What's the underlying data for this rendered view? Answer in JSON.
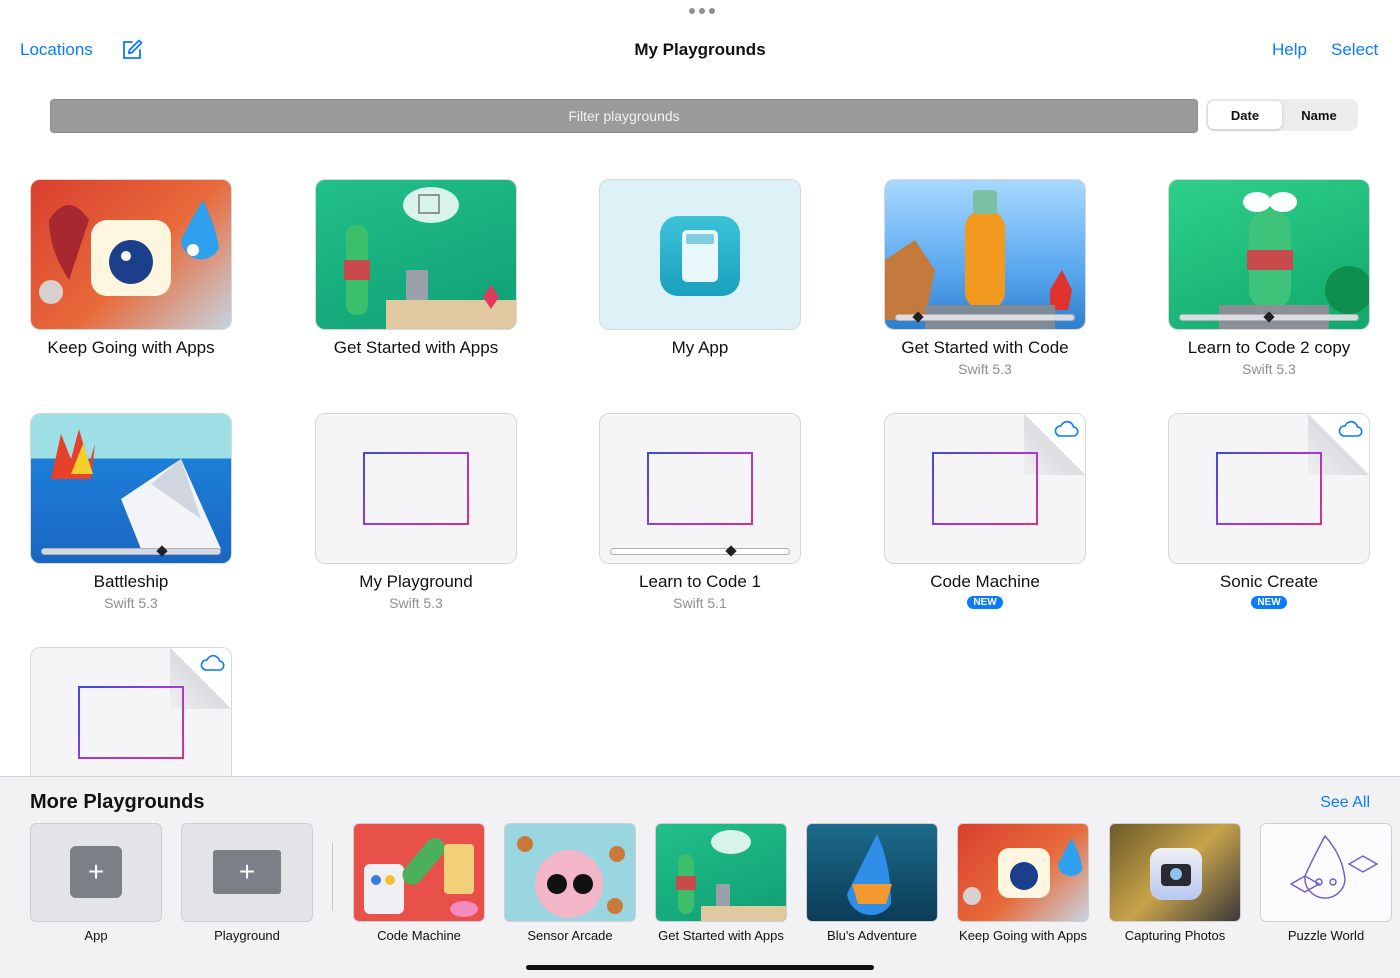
{
  "nav": {
    "locations": "Locations",
    "title": "My Playgrounds",
    "help": "Help",
    "select": "Select"
  },
  "filter": {
    "placeholder": "Filter playgrounds"
  },
  "sort": {
    "date": "Date",
    "name": "Name",
    "selected": "Date"
  },
  "cards": [
    {
      "title": "Keep Going with Apps",
      "subtitle": ""
    },
    {
      "title": "Get Started with Apps",
      "subtitle": ""
    },
    {
      "title": "My App",
      "subtitle": ""
    },
    {
      "title": "Get Started with Code",
      "subtitle": "Swift 5.3",
      "progress": 0.1
    },
    {
      "title": "Learn to Code 2 copy",
      "subtitle": "Swift 5.3",
      "progress": 0.48
    },
    {
      "title": "Battleship",
      "subtitle": "Swift 5.3",
      "progress": 0.65
    },
    {
      "title": "My Playground",
      "subtitle": "Swift 5.3"
    },
    {
      "title": "Learn to Code 1",
      "subtitle": "Swift 5.1",
      "progress": 0.65
    },
    {
      "title": "Code Machine",
      "badge": "NEW"
    },
    {
      "title": "Sonic Create",
      "badge": "NEW"
    },
    {
      "title": ""
    }
  ],
  "more": {
    "title": "More Playgrounds",
    "see_all": "See All",
    "tiles": [
      {
        "label": "App"
      },
      {
        "label": "Playground"
      },
      {
        "label": "Code Machine"
      },
      {
        "label": "Sensor Arcade"
      },
      {
        "label": "Get Started with Apps"
      },
      {
        "label": "Blu's Adventure"
      },
      {
        "label": "Keep Going with Apps"
      },
      {
        "label": "Capturing Photos"
      },
      {
        "label": "Puzzle World"
      }
    ]
  },
  "colors": {
    "accent": "#0a7aff",
    "badge": "#0a7aff"
  }
}
